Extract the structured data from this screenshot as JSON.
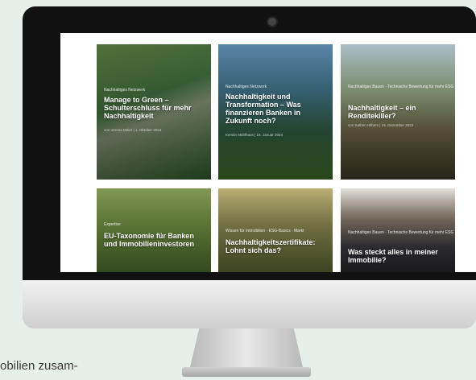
{
  "cards": [
    {
      "tag": "Nachhaltiges Netzwerk",
      "title": "Manage to Green – Schulterschluss für mehr Nachhaltigkeit",
      "meta": "von Verena Meier  |  1. Oktober 2024"
    },
    {
      "tag": "Nachhaltiges Netzwerk",
      "title": "Nachhaltigkeit und Transformation – Was finanzieren Banken in Zukunft noch?",
      "meta": "Kerstin Mühlhaus  |  16. Januar 2024"
    },
    {
      "tag": "Nachhaltiges Bauen · Technische Bewertung für mehr ESG",
      "title": "Nachhaltigkeit – ein Renditekiller?",
      "meta": "von Kathrin Hilbers  |  15. Dezember 2023"
    },
    {
      "tag": "Expertise",
      "title": "EU-Taxonomie für Banken und Immobilieninvestoren",
      "meta": ""
    },
    {
      "tag": "Wissen für Immobilien · ESG-Basics · Markt",
      "title": "Nachhaltigkeitszertifikate: Lohnt sich das?",
      "meta": ""
    },
    {
      "tag": "Nachhaltiges Bauen · Technische Bewertung für mehr ESG",
      "title": "Was steckt alles in meiner Immobilie?",
      "meta": ""
    }
  ],
  "caption": "obilien zusam-"
}
